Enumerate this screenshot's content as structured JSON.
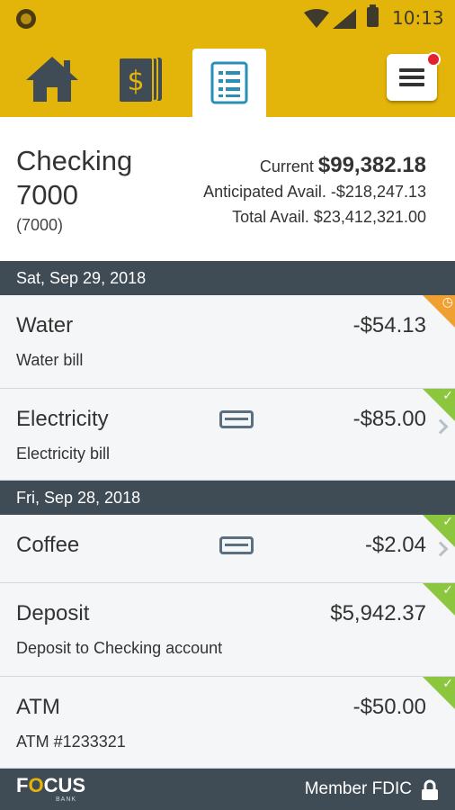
{
  "status_bar": {
    "time": "10:13",
    "icons": [
      "app-indicator-icon",
      "wifi-icon",
      "signal-icon",
      "battery-icon"
    ]
  },
  "nav": {
    "items": [
      {
        "icon": "home-icon"
      },
      {
        "icon": "dollar-card-icon"
      },
      {
        "icon": "document-list-icon",
        "active": true
      },
      {
        "icon": "menu-icon",
        "has_badge": true
      }
    ],
    "colors": {
      "bar": "#e3b50a",
      "badge": "#e3202e",
      "active_icon": "#2a8fb8"
    }
  },
  "account": {
    "name": "Checking 7000",
    "number": "(7000)",
    "current_label": "Current",
    "current_value": "$99,382.18",
    "anticipated_label": "Anticipated Avail.",
    "anticipated_value": "-$218,247.13",
    "total_label": "Total Avail.",
    "total_value": "$23,412,321.00"
  },
  "groups": [
    {
      "date": "Sat, Sep 29, 2018",
      "transactions": [
        {
          "title": "Water",
          "subtitle": "Water bill",
          "amount": "-$54.13",
          "status": "pending"
        },
        {
          "title": "Electricity",
          "subtitle": "Electricity bill",
          "amount": "-$85.00",
          "status": "cleared",
          "card": true,
          "chevron": true
        }
      ]
    },
    {
      "date": "Fri, Sep 28, 2018",
      "transactions": [
        {
          "title": "Coffee",
          "subtitle": "",
          "amount": "-$2.04",
          "status": "cleared",
          "card": true,
          "chevron": true
        },
        {
          "title": "Deposit",
          "subtitle": "Deposit to Checking account",
          "amount": "$5,942.37",
          "status": "cleared"
        },
        {
          "title": "ATM",
          "subtitle": "ATM #1233321",
          "amount": "-$50.00",
          "status": "cleared"
        }
      ]
    }
  ],
  "footer": {
    "logo_pre": "F",
    "logo_o": "O",
    "logo_post": "CUS",
    "logo_sub": "BANK",
    "fdic": "Member FDIC"
  },
  "colors": {
    "date_bar": "#3f4b55",
    "cleared": "#8cc63f",
    "pending": "#f0a030"
  }
}
